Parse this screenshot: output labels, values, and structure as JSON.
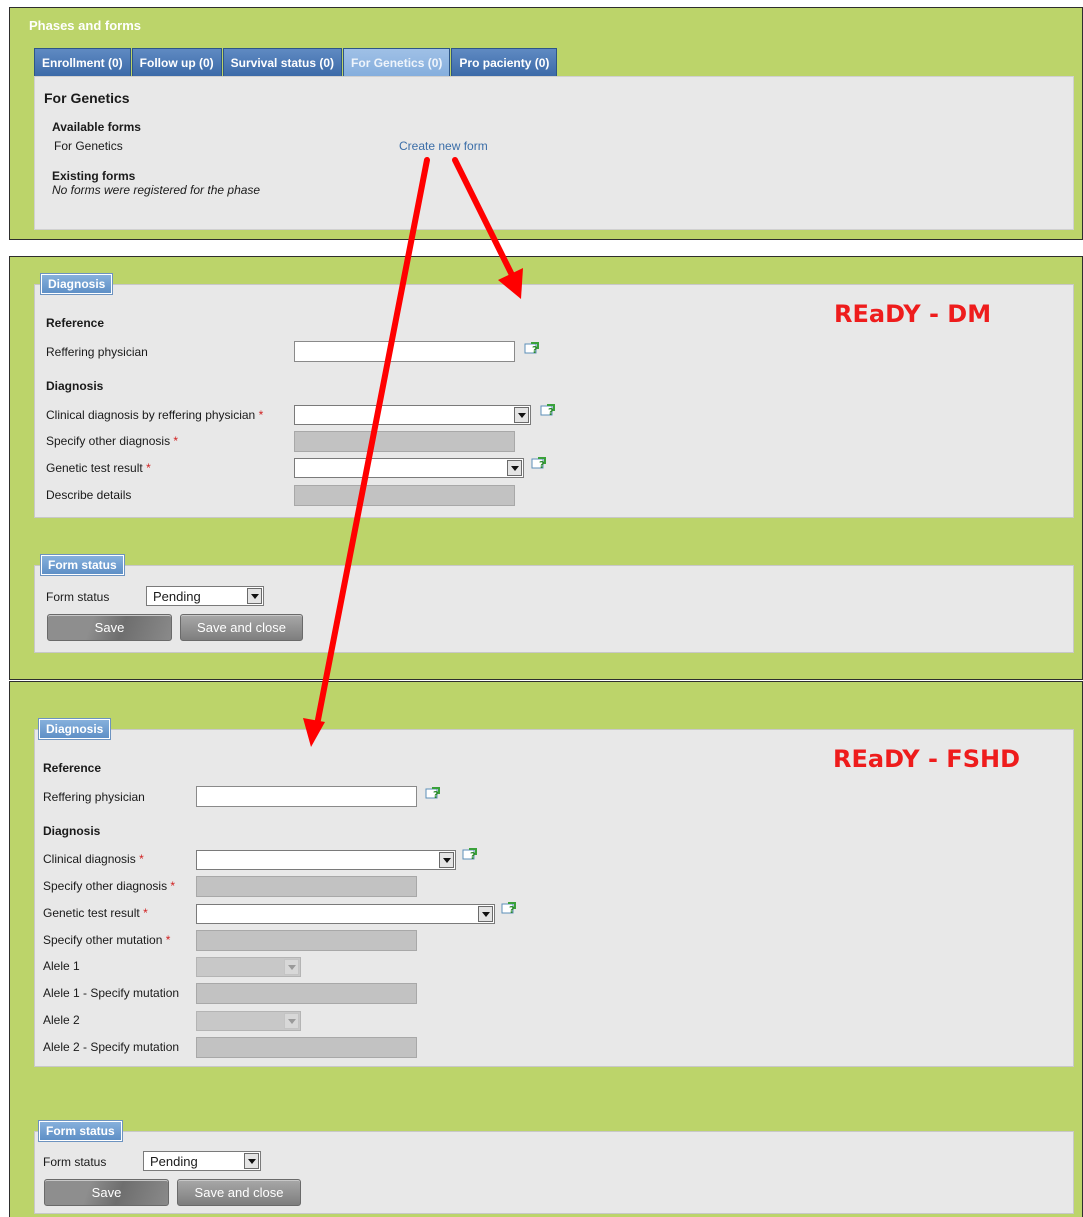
{
  "phases": {
    "title": "Phases and forms",
    "tabs": [
      {
        "label": "Enrollment (0)"
      },
      {
        "label": "Follow up (0)"
      },
      {
        "label": "Survival status (0)"
      },
      {
        "label": "For Genetics (0)"
      },
      {
        "label": "Pro pacienty (0)"
      }
    ],
    "active_tab": "For Genetics (0)",
    "heading": "For Genetics",
    "available_forms_label": "Available forms",
    "available_form": "For Genetics",
    "create_link": "Create new form",
    "existing_forms_label": "Existing forms",
    "existing_forms_empty": "No forms were registered for the phase"
  },
  "dm_form": {
    "annotation": "REaDY - DM",
    "legend": "Diagnosis",
    "reference_heading": "Reference",
    "referring_physician_label": "Reffering physician",
    "diagnosis_heading": "Diagnosis",
    "clinical_diagnosis_label": "Clinical diagnosis by reffering physician",
    "specify_other_diagnosis_label": "Specify other diagnosis",
    "genetic_test_label": "Genetic test result",
    "describe_details_label": "Describe details",
    "required_marker": "*",
    "status_legend": "Form status",
    "status_label": "Form status",
    "status_value": "Pending",
    "save_label": "Save",
    "save_close_label": "Save and close"
  },
  "fshd_form": {
    "annotation": "REaDY - FSHD",
    "legend": "Diagnosis",
    "reference_heading": "Reference",
    "referring_physician_label": "Reffering physician",
    "diagnosis_heading": "Diagnosis",
    "clinical_diagnosis_label": "Clinical diagnosis",
    "specify_other_diagnosis_label": "Specify other diagnosis",
    "genetic_test_label": "Genetic test result",
    "specify_other_mutation_label": "Specify other mutation",
    "alele1_label": "Alele 1",
    "alele1_mutation_label": "Alele 1 - Specify mutation",
    "alele2_label": "Alele 2",
    "alele2_mutation_label": "Alele 2 - Specify mutation",
    "required_marker": "*",
    "status_legend": "Form status",
    "status_label": "Form status",
    "status_value": "Pending",
    "save_label": "Save",
    "save_close_label": "Save and close"
  },
  "colors": {
    "panel_green": "#bcd46a",
    "tab_blue": "#4a78b5",
    "annotation_red": "#ee1c1c",
    "arrow_red": "#ff0000"
  }
}
